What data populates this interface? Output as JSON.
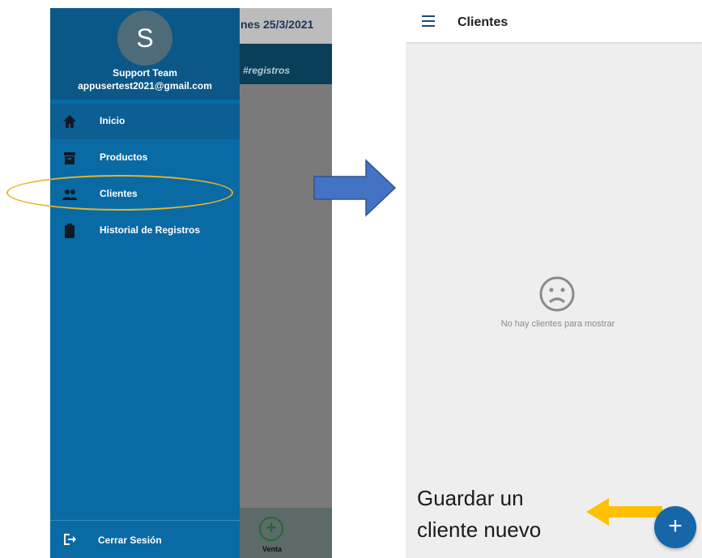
{
  "background_screen": {
    "date": "nes 25/3/2021",
    "tag": "#registros",
    "venta_label": "Venta"
  },
  "drawer": {
    "avatar_letter": "S",
    "user_name": "Support Team",
    "user_email": "appusertest2021@gmail.com",
    "items": [
      {
        "label": "Inicio",
        "icon": "home-icon"
      },
      {
        "label": "Productos",
        "icon": "archive-icon"
      },
      {
        "label": "Clientes",
        "icon": "people-icon"
      },
      {
        "label": "Historial de Registros",
        "icon": "clipboard-icon"
      }
    ],
    "logout_label": "Cerrar Sesión"
  },
  "clientes_screen": {
    "title": "Clientes",
    "empty_message": "No hay clientes para mostrar"
  },
  "annotation": {
    "line1": "Guardar un",
    "line2": "cliente nuevo"
  },
  "colors": {
    "drawer": "#0a6aa4",
    "highlight": "#e5b52a",
    "arrow_blue": "#4472c4",
    "arrow_yellow": "#ffc000",
    "fab": "#1767a8"
  }
}
